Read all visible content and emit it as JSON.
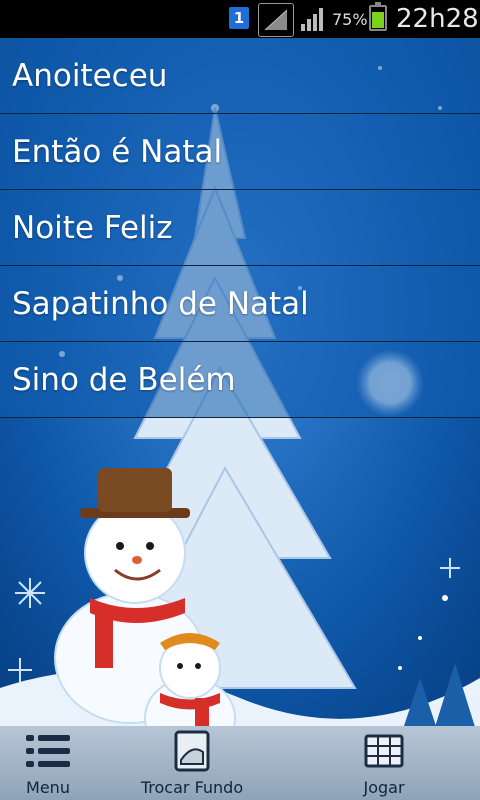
{
  "status_bar": {
    "sim_label": "1",
    "battery_percent": "75%",
    "battery_level": 0.75,
    "time": "22h28",
    "icons": [
      "sim-1-icon",
      "signal-box-icon",
      "cell-signal-icon",
      "battery-icon"
    ]
  },
  "songs": [
    {
      "label": "Anoiteceu"
    },
    {
      "label": "Então é Natal"
    },
    {
      "label": "Noite Feliz"
    },
    {
      "label": "Sapatinho de Natal"
    },
    {
      "label": "Sino de Belém"
    }
  ],
  "bottom_bar": {
    "menu": {
      "label": "Menu",
      "icon": "list-icon"
    },
    "change_background": {
      "label": "Trocar Fundo",
      "icon": "picture-icon"
    },
    "play": {
      "label": "Jogar",
      "icon": "grid-icon"
    }
  },
  "colors": {
    "background_blue": "#0a4d9a",
    "list_overlay": "#125caf",
    "status_bar": "#000000",
    "bottom_bar": "#a9bacb",
    "battery_fill": "#7bd21a",
    "sim_badge": "#1d6fd6"
  }
}
